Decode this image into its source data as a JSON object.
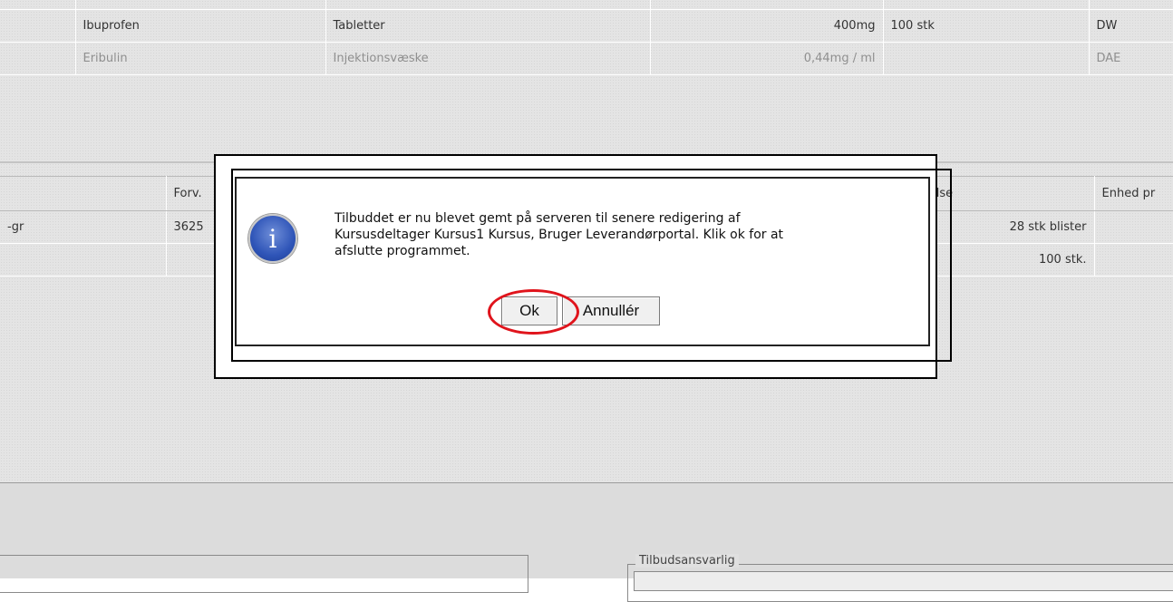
{
  "products": {
    "rows": [
      {
        "name": "Ibuprofen",
        "form": "Tabletter",
        "strength": "400mg",
        "pack": "100 stk",
        "code": "DW",
        "muted": false
      },
      {
        "name": "Eribulin",
        "form": "Injektionsvæske",
        "strength": "0,44mg / ml",
        "pack": "",
        "code": "DAE",
        "muted": true
      }
    ]
  },
  "offers": {
    "headers": {
      "col1": "",
      "col2": "Forv.",
      "col3": "ngsstørrelse",
      "col4": "Enhed pr"
    },
    "rows": [
      {
        "c1": "-gr",
        "c2": "3625",
        "c3": "28 stk blister",
        "c4": ""
      },
      {
        "c1": "",
        "c2": "",
        "c3": "100 stk.",
        "c4": ""
      }
    ]
  },
  "footer": {
    "responsible_legend": "Tilbudsansvarlig"
  },
  "dialog": {
    "message_line1": "Tilbuddet er nu blevet gemt på serveren til senere redigering af",
    "message_line2": "Kursusdeltager Kursus1 Kursus, Bruger Leverandørportal. Klik ok for at",
    "message_line3": "afslutte programmet.",
    "ok_label": "Ok",
    "cancel_label": "Annullér",
    "icon": "info-icon",
    "icon_glyph": "i",
    "highlight_color": "#e0141c"
  }
}
